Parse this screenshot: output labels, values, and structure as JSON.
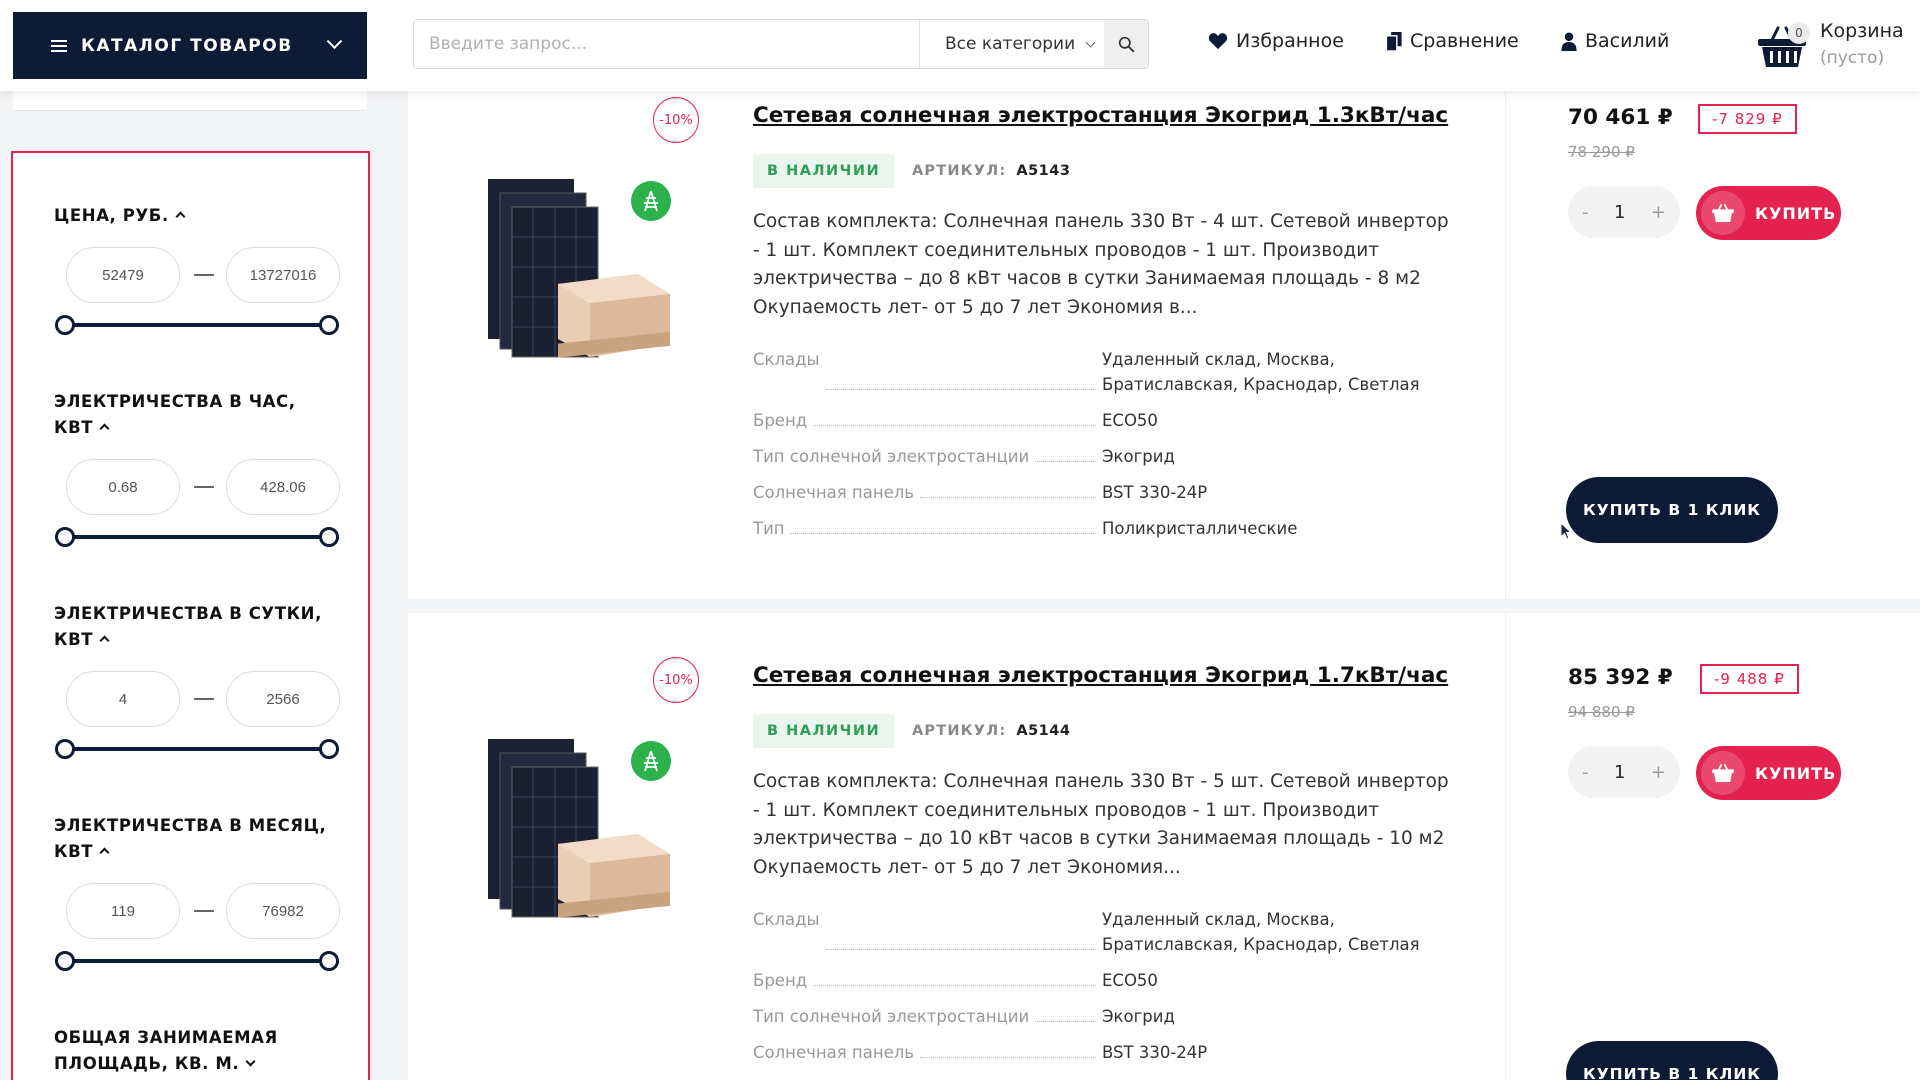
{
  "header": {
    "catalog_label": "КАТАЛОГ ТОВАРОВ",
    "search_placeholder": "Введите запрос...",
    "search_category": "Все категории",
    "favorites": "Избранное",
    "compare": "Сравнение",
    "user": "Василий",
    "cart_count": "0",
    "cart_label": "Корзина",
    "cart_status": "(пусто)"
  },
  "filters": [
    {
      "title": "ЦЕНА, РУБ.",
      "min": "52479",
      "max": "13727016",
      "expanded": true
    },
    {
      "title": "ЭЛЕКТРИЧЕСТВА В ЧАС, КВТ",
      "min": "0.68",
      "max": "428.06",
      "expanded": true
    },
    {
      "title": "ЭЛЕКТРИЧЕСТВА В СУТКИ, КВТ",
      "min": "4",
      "max": "2566",
      "expanded": true
    },
    {
      "title": "ЭЛЕКТРИЧЕСТВА В МЕСЯЦ, КВТ",
      "min": "119",
      "max": "76982",
      "expanded": true
    },
    {
      "title": "ОБЩАЯ ЗАНИМАЕМАЯ ПЛОЩАДЬ, КВ. М.",
      "expanded": false
    }
  ],
  "products": [
    {
      "discount_pct": "-10%",
      "title": "Сетевая солнечная электростанция Экогрид 1.3кВт/час",
      "stock": "В НАЛИЧИИ",
      "sku_label": "АРТИКУЛ:",
      "sku": "A5143",
      "description": "Состав комплекта: Солнечная панель 330 Вт - 4 шт. Сетевой инвертор - 1 шт. Комплект соединительных проводов - 1 шт. Производит электричества – до 8 кВт часов в сутки Занимаемая площадь - 8 м2 Окупаемость лет- от 5 до 7 лет Экономия в...",
      "props": [
        {
          "k": "Склады",
          "v": "Удаленный склад, Москва, Братиславская, Краснодар, Светлая"
        },
        {
          "k": "Бренд",
          "v": "ECO50"
        },
        {
          "k": "Тип солнечной электростанции",
          "v": "Экогрид"
        },
        {
          "k": "Солнечная панель",
          "v": "BST 330-24P"
        },
        {
          "k": "Тип",
          "v": "Поликристаллические"
        }
      ],
      "price": "70 461 ₽",
      "old_price": "78 290 ₽",
      "saving": "-7 829 ₽",
      "qty": "1",
      "buy_label": "КУПИТЬ",
      "oneclick_label": "КУПИТЬ В 1 КЛИК"
    },
    {
      "discount_pct": "-10%",
      "title": "Сетевая солнечная электростанция Экогрид 1.7кВт/час",
      "stock": "В НАЛИЧИИ",
      "sku_label": "АРТИКУЛ:",
      "sku": "A5144",
      "description": "Состав комплекта: Солнечная панель 330 Вт - 5 шт. Сетевой инвертор - 1 шт. Комплект соединительных проводов - 1 шт. Производит электричества – до 10 кВт часов в сутки Занимаемая площадь - 10 м2 Окупаемость лет- от 5 до 7 лет Экономия...",
      "props": [
        {
          "k": "Склады",
          "v": "Удаленный склад, Москва, Братиславская, Краснодар, Светлая"
        },
        {
          "k": "Бренд",
          "v": "ECO50"
        },
        {
          "k": "Тип солнечной электростанции",
          "v": "Экогрид"
        },
        {
          "k": "Солнечная панель",
          "v": "BST 330-24P"
        }
      ],
      "price": "85 392 ₽",
      "old_price": "94 880 ₽",
      "saving": "-9 488 ₽",
      "qty": "1",
      "buy_label": "КУПИТЬ",
      "oneclick_label": "КУПИТЬ В 1 КЛИК"
    }
  ],
  "colors": {
    "navy": "#0d1b36",
    "accent": "#e4224f",
    "in_stock": "#2f9e55",
    "eco": "#2bb24c"
  },
  "icons": [
    "menu-icon",
    "chevron-down-icon",
    "search-icon",
    "heart-icon",
    "compare-icon",
    "user-icon",
    "basket-icon",
    "eco-power-icon"
  ]
}
